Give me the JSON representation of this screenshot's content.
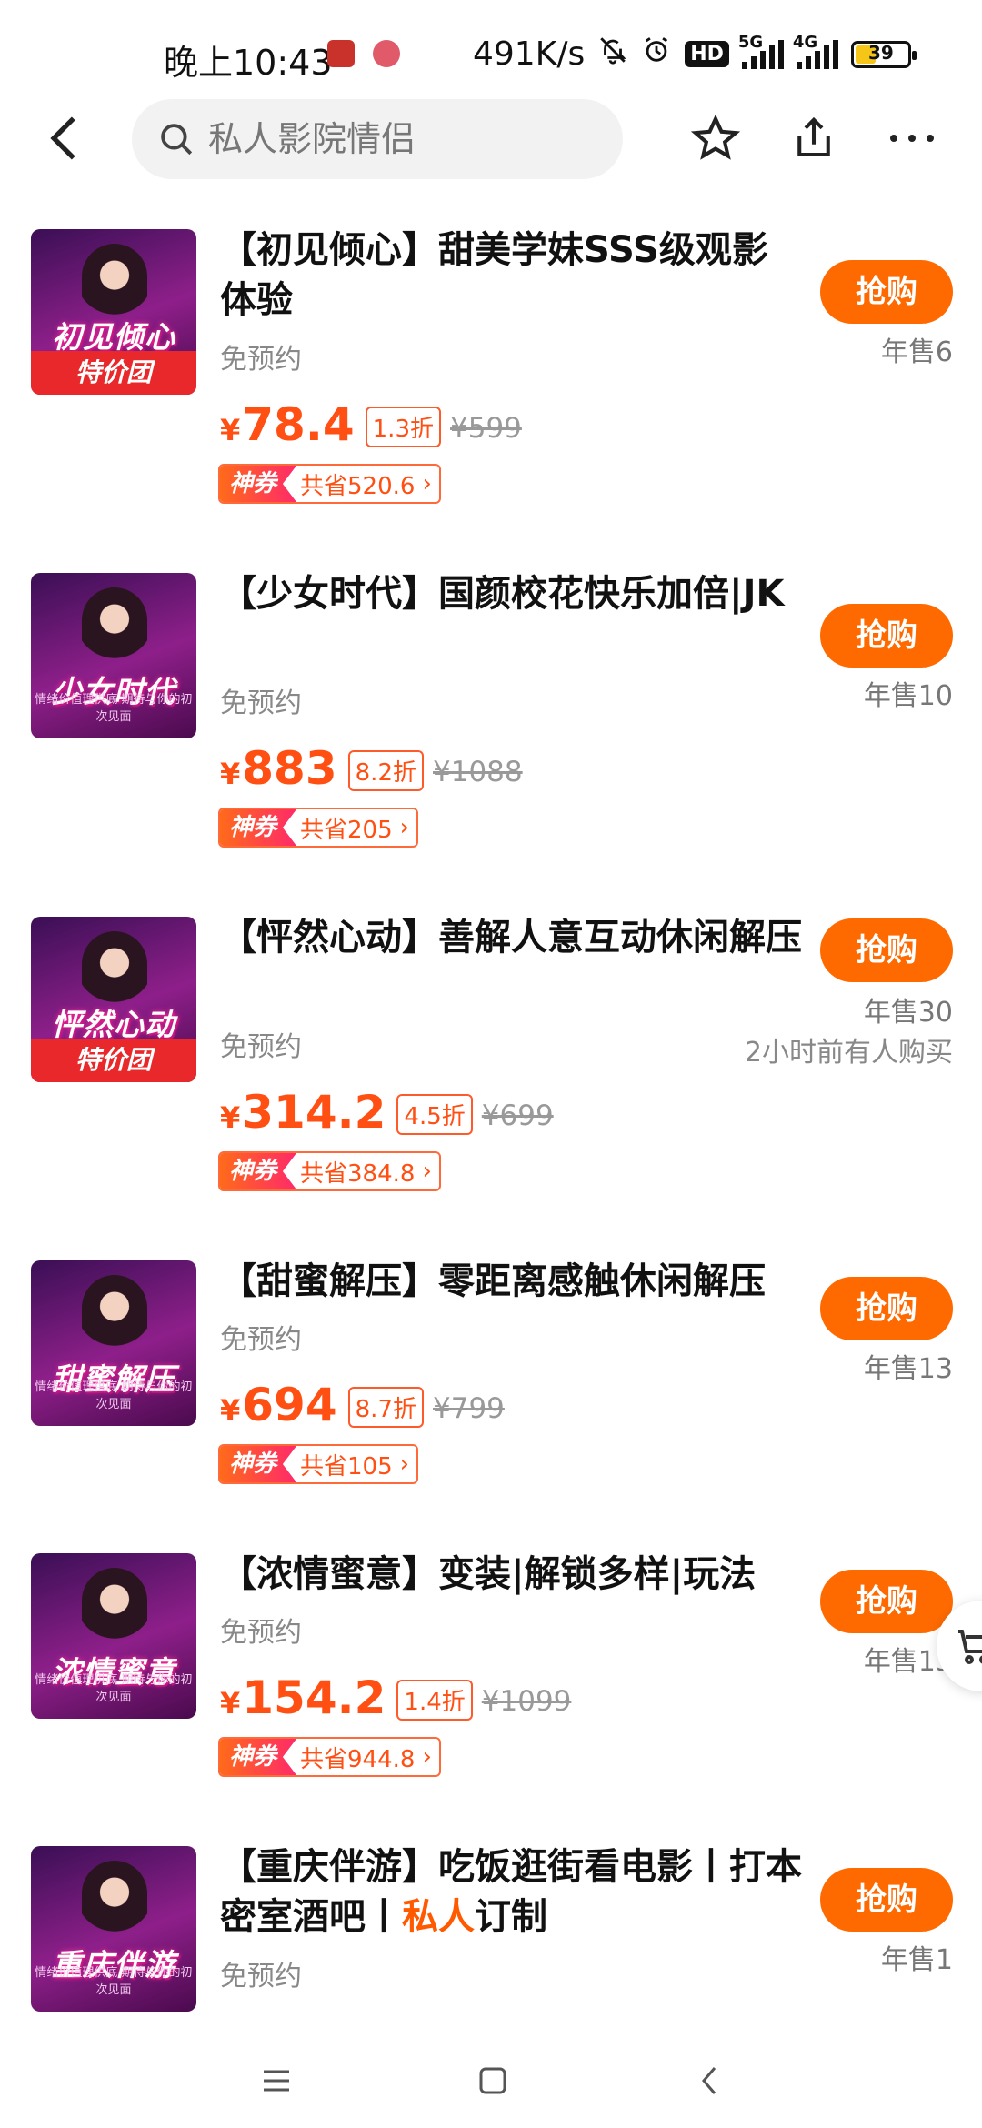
{
  "status_bar": {
    "time": "晚上10:43",
    "net_speed": "491K/s",
    "hd_badge": "HD",
    "sim1_tag": "5G",
    "sim2_tag": "4G",
    "battery": "39",
    "battery_level": 0.39
  },
  "header": {
    "search_placeholder": "私人影院情侣",
    "icons": [
      "back-icon",
      "search-icon",
      "star-icon",
      "share-icon",
      "more-icon"
    ]
  },
  "theme": {
    "accent": "#ff6a00",
    "price": "#ff4f12",
    "coupon_gradient": [
      "#ff6a1a",
      "#ff2a6a"
    ]
  },
  "items": [
    {
      "thumb_title": "初见倾心",
      "thumb_banner": "特价团",
      "thumb_sub": "",
      "title_main": "【初见倾心】甜美学妹SSS级观影体验",
      "title_highlight": "",
      "title_tail": "",
      "booking": "免预约",
      "price_symbol": "¥",
      "price": "78.4",
      "discount": "1.3折",
      "orig_price": "¥599",
      "coupon_tag": "神券",
      "coupon_text": "共省520.6",
      "buy_label": "抢购",
      "yearly_sales": "年售6",
      "recent": ""
    },
    {
      "thumb_title": "少女时代",
      "thumb_banner": "",
      "thumb_sub": "情绪价值理供底 期待与你的初次见面",
      "title_main": "【少女时代】国颜校花快乐加倍|JK",
      "title_highlight": "",
      "title_tail": "",
      "booking": "免预约",
      "price_symbol": "¥",
      "price": "883",
      "discount": "8.2折",
      "orig_price": "¥1088",
      "coupon_tag": "神券",
      "coupon_text": "共省205",
      "buy_label": "抢购",
      "yearly_sales": "年售10",
      "recent": ""
    },
    {
      "thumb_title": "怦然心动",
      "thumb_banner": "特价团",
      "thumb_sub": "",
      "title_main": "【怦然心动】善解人意互动休闲解压",
      "title_highlight": "",
      "title_tail": "",
      "booking": "免预约",
      "price_symbol": "¥",
      "price": "314.2",
      "discount": "4.5折",
      "orig_price": "¥699",
      "coupon_tag": "神券",
      "coupon_text": "共省384.8",
      "buy_label": "抢购",
      "yearly_sales": "年售30",
      "recent": "2小时前有人购买"
    },
    {
      "thumb_title": "甜蜜解压",
      "thumb_banner": "",
      "thumb_sub": "情绪价值理供底 期待与你的初次见面",
      "title_main": "【甜蜜解压】零距离感触休闲解压",
      "title_highlight": "",
      "title_tail": "",
      "booking": "免预约",
      "price_symbol": "¥",
      "price": "694",
      "discount": "8.7折",
      "orig_price": "¥799",
      "coupon_tag": "神券",
      "coupon_text": "共省105",
      "buy_label": "抢购",
      "yearly_sales": "年售13",
      "recent": ""
    },
    {
      "thumb_title": "浓情蜜意",
      "thumb_banner": "",
      "thumb_sub": "情绪价值理供底 期待与你的初次见面",
      "title_main": "【浓情蜜意】变装|解锁多样|玩法",
      "title_highlight": "",
      "title_tail": "",
      "booking": "免预约",
      "price_symbol": "¥",
      "price": "154.2",
      "discount": "1.4折",
      "orig_price": "¥1099",
      "coupon_tag": "神券",
      "coupon_text": "共省944.8",
      "buy_label": "抢购",
      "yearly_sales": "年售13",
      "recent": ""
    },
    {
      "thumb_title": "重庆伴游",
      "thumb_banner": "",
      "thumb_sub": "情绪价值理供底 期待与你的初次见面",
      "title_main": "【重庆伴游】吃饭逛街看电影丨打本密室酒吧丨",
      "title_highlight": "私人",
      "title_tail": "订制",
      "booking": "免预约",
      "price_symbol": "",
      "price": "",
      "discount": "",
      "orig_price": "",
      "coupon_tag": "",
      "coupon_text": "",
      "buy_label": "抢购",
      "yearly_sales": "年售1",
      "recent": ""
    }
  ]
}
